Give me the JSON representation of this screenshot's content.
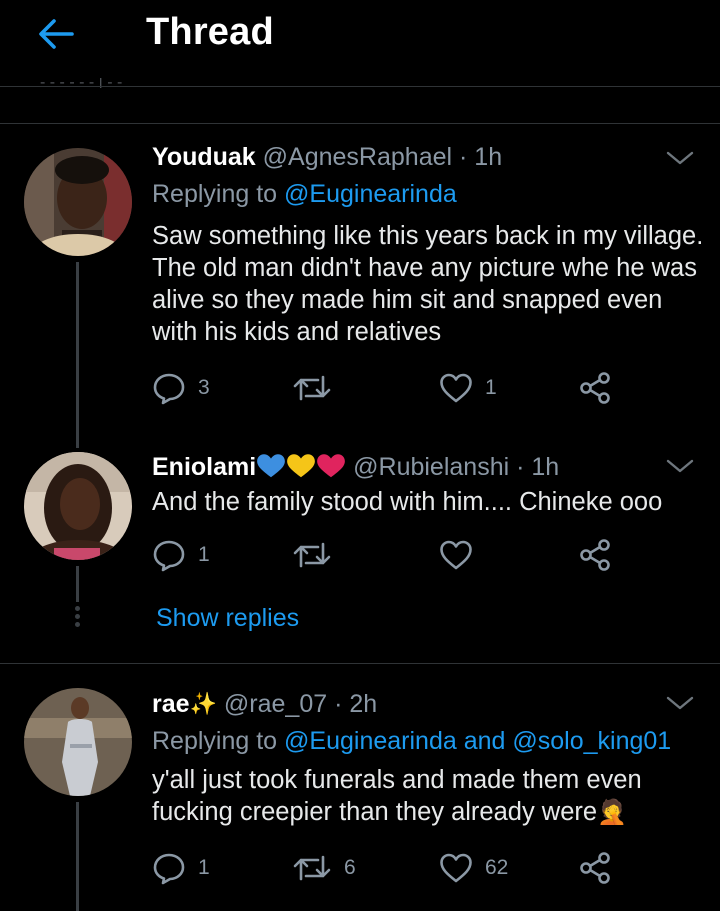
{
  "header": {
    "title": "Thread",
    "peek_text": "- - - - - - | - -"
  },
  "tweets": [
    {
      "name": "Youduak",
      "handle": "@AgnesRaphael",
      "time": "· 1h",
      "replying_prefix": "Replying to",
      "replying_to": "@Euginearinda",
      "replying_joiner": "",
      "replying_to2": "",
      "text": "Saw something like this years back in my village. The old man didn't have any picture whe he was alive so they made him sit and snapped even with his kids and relatives",
      "reply_count": "3",
      "retweet_count": "",
      "like_count": "1",
      "avatar_colors": {
        "bg": "#5a4a3e",
        "skin": "#3b2418"
      }
    },
    {
      "name": "Eniolami",
      "handle": "@Rubielanshi",
      "time": "· 1h",
      "hearts": [
        "#3d8fe0",
        "#f5c518",
        "#e0245e"
      ],
      "text": "And the family stood with him.... Chineke ooo",
      "reply_count": "1",
      "retweet_count": "",
      "like_count": "",
      "avatar_colors": {
        "bg": "#c9b7a3",
        "skin": "#4a2b1c"
      }
    },
    {
      "name": "rae",
      "name_emoji": "✨",
      "handle": "@rae_07",
      "time": "· 2h",
      "replying_prefix": "Replying to",
      "replying_to": "@Euginearinda",
      "replying_joiner": "and",
      "replying_to2": "@solo_king01",
      "text": "y'all just took funerals and made them even fucking creepier than they already were",
      "text_emoji": "🤦",
      "reply_count": "1",
      "retweet_count": "6",
      "like_count": "62",
      "avatar_colors": {
        "bg": "#8a7860",
        "skin": "#5b3a26"
      }
    }
  ],
  "show_replies": "Show replies",
  "colors": {
    "accent": "#1d9bf0",
    "muted": "#8b98a5",
    "background": "#000000",
    "divider": "#2f3336"
  },
  "icons": [
    "back-arrow-icon",
    "chevron-down-icon",
    "reply-icon",
    "retweet-icon",
    "like-icon",
    "share-icon"
  ]
}
